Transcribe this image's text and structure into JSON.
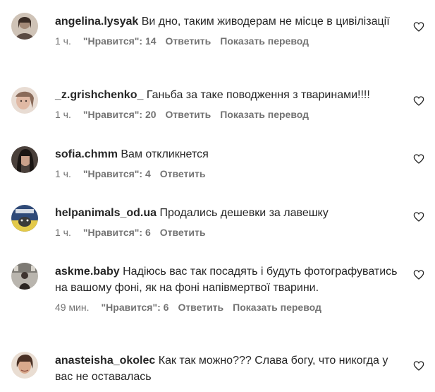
{
  "comments": [
    {
      "username": "angelina.lysyak",
      "text": "Ви дно, таким живодерам не місце в цивілізації",
      "time": "1 ч.",
      "likes": "\"Нравится\": 14",
      "reply": "Ответить",
      "translate": "Показать перевод",
      "avatar_color": "#b8a79a"
    },
    {
      "username": "_z.grishchenko_",
      "text": "Ганьба за таке поводження з тваринами!!!!",
      "time": "1 ч.",
      "likes": "\"Нравится\": 20",
      "reply": "Ответить",
      "translate": "Показать перевод",
      "avatar_color": "#d9b9a8"
    },
    {
      "username": "sofia.chmm",
      "text": "Вам откликнется",
      "time": "1 ч.",
      "likes": "\"Нравится\": 4",
      "reply": "Ответить",
      "translate": "",
      "avatar_color": "#2a2320"
    },
    {
      "username": "helpanimals_od.ua",
      "text": "Продались дешевки за лавешку",
      "time": "1 ч.",
      "likes": "\"Нравится\": 6",
      "reply": "Ответить",
      "translate": "",
      "avatar_color": "#3a4f6e"
    },
    {
      "username": "askme.baby",
      "text": "Надіюсь вас так посадять і будуть фотографуватись на вашому фоні, як на фоні напівмертвої тварини.",
      "time": "49 мин.",
      "likes": "\"Нравится\": 6",
      "reply": "Ответить",
      "translate": "Показать перевод",
      "avatar_color": "#8c8a86"
    },
    {
      "username": "anasteisha_okolec",
      "text": "Как так можно??? Слава богу, что никогда у вас не оставалась",
      "time": "",
      "likes": "",
      "reply": "",
      "translate": "",
      "avatar_color": "#c9a58c"
    }
  ],
  "icons": {
    "like": "heart-outline-icon"
  },
  "colors": {
    "text": "#262626",
    "meta": "#737373"
  }
}
